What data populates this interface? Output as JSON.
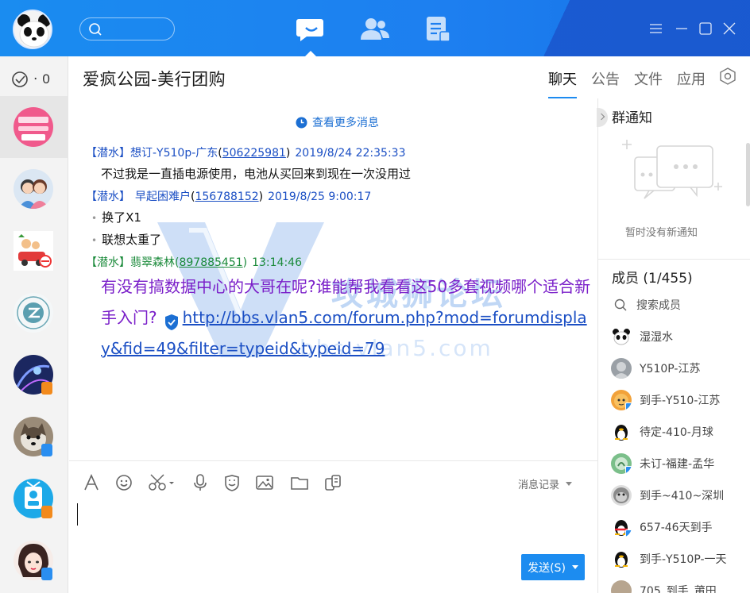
{
  "window": {
    "title": "爱疯公园-美行团购",
    "controls": [
      "menu-icon",
      "minimize-icon",
      "maximize-icon",
      "close-icon"
    ]
  },
  "nav": {
    "items": [
      "messages-icon",
      "contacts-icon",
      "apps-icon"
    ],
    "active": "messages-icon"
  },
  "left": {
    "status_count": "0"
  },
  "tabs": [
    "聊天",
    "公告",
    "文件",
    "应用"
  ],
  "chat": {
    "more_messages": "查看更多消息",
    "messages": [
      {
        "tag": "【潜水】",
        "nick": "想订-Y510p-广东",
        "qq": "506225981",
        "time": "2019/8/24 22:35:33",
        "lines": [
          "不过我是一直插电源使用，电池从买回来到现在一次没用过"
        ]
      },
      {
        "tag": "【潜水】",
        "nick": "早起困难户",
        "qq": "156788152",
        "time": "2019/8/25 9:00:17",
        "lines": [
          "换了X1",
          "联想太重了"
        ]
      },
      {
        "tag": "【潜水】",
        "nick": "翡翠森林",
        "qq": "897885451",
        "time": "13:14:46",
        "text_part1": "有没有搞数据中心的大哥在呢?谁能帮我看看这50多套视频哪个适合新手入门?",
        "link": "http://bbs.vlan5.com/forum.php?mod=forumdisplay&fid=49&filter=typeid&typeid=79"
      }
    ],
    "watermark_text": "攻城狮论坛",
    "watermark_url": "bbs.vlan5.com"
  },
  "composer": {
    "tools": [
      "font-icon",
      "emoji-icon",
      "screenshot-icon",
      "voice-icon",
      "sticker-icon",
      "image-icon",
      "folder-icon",
      "more-icon"
    ],
    "history_label": "消息记录",
    "send_label": "发送(S)"
  },
  "right": {
    "notice_title": "群通知",
    "notice_empty": "暂时没有新通知",
    "members_title": "成员 (1/455)",
    "search_members": "搜索成员",
    "members": [
      {
        "name": "湿湿水",
        "avatar": "panda"
      },
      {
        "name": "Y510P-江苏",
        "avatar": "gray"
      },
      {
        "name": "到手-Y510-江苏",
        "avatar": "orange"
      },
      {
        "name": "待定-410-月球",
        "avatar": "penguin"
      },
      {
        "name": "未订-福建-孟华",
        "avatar": "green"
      },
      {
        "name": "到手~410~深圳",
        "avatar": "monkey"
      },
      {
        "name": "657-46天到手",
        "avatar": "penguin"
      },
      {
        "name": "到手-Y510P-一天",
        "avatar": "penguin"
      },
      {
        "name": "705_到手_莆田",
        "avatar": "gray"
      }
    ]
  }
}
